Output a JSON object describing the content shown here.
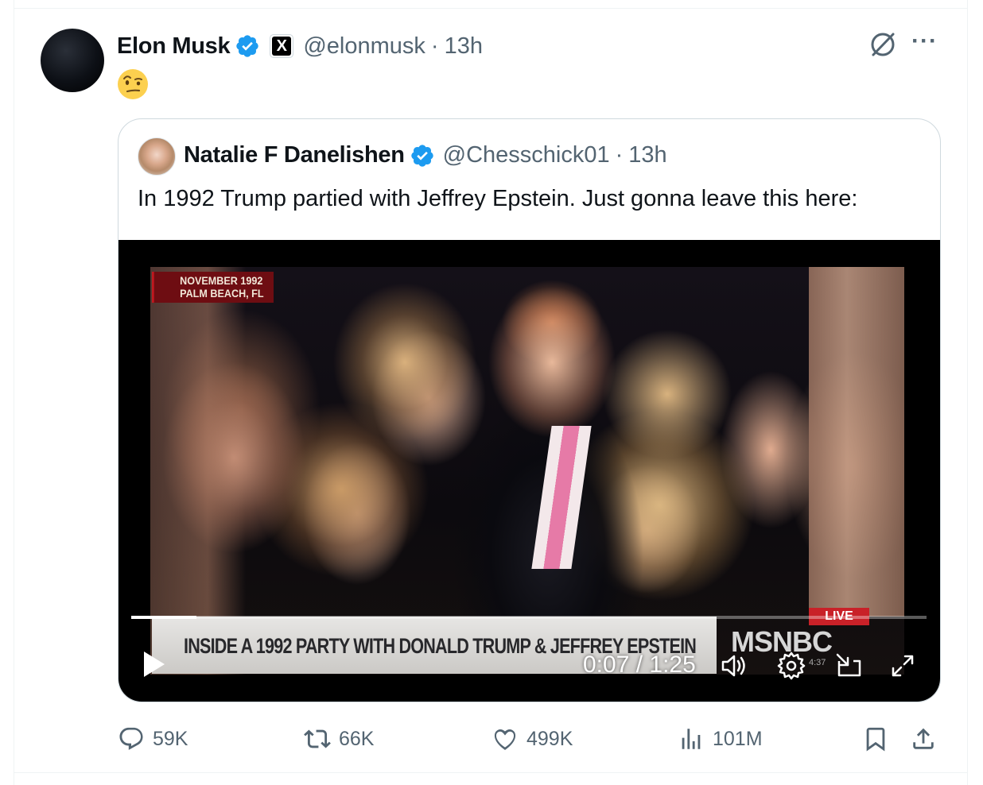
{
  "tweet": {
    "author_name": "Elon Musk",
    "author_handle": "@elonmusk",
    "separator": "·",
    "time": "13h",
    "emoji_name": "face-with-raised-eyebrow-emoji",
    "affiliate_badge": "X"
  },
  "quoted": {
    "author_name": "Natalie F Danelishen",
    "author_handle": "@Chesschick01",
    "separator": "·",
    "time": "13h",
    "text": "In 1992 Trump partied with Jeffrey Epstein. Just gonna leave this here:",
    "video": {
      "location_line1": "NOVEMBER 1992",
      "location_line2": "PALM BEACH, FL",
      "chyron": "INSIDE A 1992 PARTY WITH DONALD TRUMP & JEFFREY EPSTEIN",
      "live_badge": "LIVE",
      "network": "MSNBC",
      "network_clock": "4:37",
      "timecode": "0:07 / 1:25",
      "progress_fraction": 0.082
    }
  },
  "actions": {
    "replies": "59K",
    "reposts": "66K",
    "likes": "499K",
    "views": "101M"
  },
  "colors": {
    "verified_blue": "#1d9bf0",
    "text_primary": "#0f1419",
    "text_secondary": "#536471",
    "border": "#cfd9de"
  }
}
